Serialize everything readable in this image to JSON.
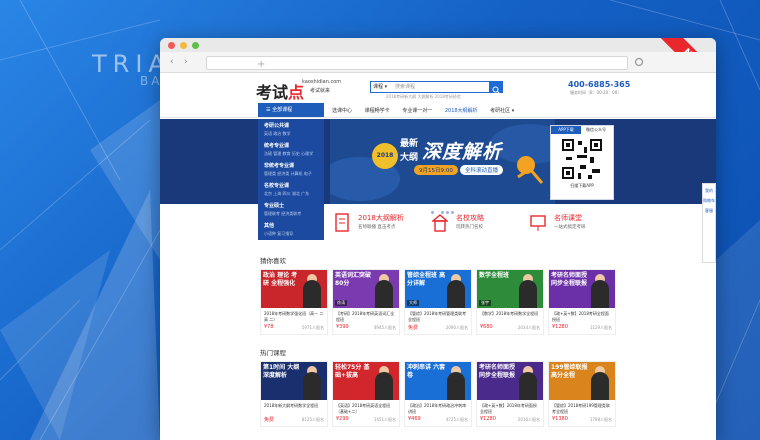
{
  "background": {
    "title": "TRIA",
    "subtitle": "BA"
  },
  "browser": {
    "ribbon": "NEW",
    "back": "‹",
    "forward": "›",
    "new_tab": "+"
  },
  "header": {
    "logo_main": "考试",
    "logo_accent": "点",
    "logo_domain": "kaoshidian.com",
    "logo_tagline": "考试就来",
    "search_select": "课程 ▾",
    "search_placeholder": "搜索课程",
    "hot_links": "2018考研新大纲  大纲解析  2018考研经验",
    "phone": "400-6885-365",
    "phone_hours": "服务时间（8：00-20：00）"
  },
  "menu": {
    "all_categories": "全部课程",
    "items": [
      "选课中心",
      "课程畅学卡",
      "专业课一对一",
      "2018大纲解析",
      "考研社区 ▾"
    ],
    "active_index": 3
  },
  "categories": [
    {
      "title": "考研公共课",
      "sub": "英语 政治 数学"
    },
    {
      "title": "统考专业课",
      "sub": "法硕 管理 教育 历史 心理学"
    },
    {
      "title": "非统考专业课",
      "sub": "管理类 经济类 计算机 电子"
    },
    {
      "title": "名校专业课",
      "sub": "北京 上海 四川 湖北 广东"
    },
    {
      "title": "专业硕士",
      "sub": "管理联考 经济类联考"
    },
    {
      "title": "其他",
      "sub": "小语种 复习指导"
    }
  ],
  "banner": {
    "year": "2018",
    "line1": "最新",
    "line2": "大纲",
    "headline": "深度解析",
    "date": "9月15日9:00",
    "live": "全科滚动直播"
  },
  "qr": {
    "tab1": "APP下载",
    "tab2": "微信公众号",
    "caption": "扫描下载APP"
  },
  "features": [
    {
      "title": "2018大纲解析",
      "sub": "名师联播  直击考点"
    },
    {
      "title": "名校攻略",
      "sub": "玩转热门名校"
    },
    {
      "title": "名师课堂",
      "sub": "一站式搞定考研"
    }
  ],
  "section1": {
    "title": "猜你喜欢",
    "cards": [
      {
        "caption": "政治 理论 考研 全程强化",
        "tag": "",
        "title": "2018年考研数学强化班（高一 二高 二）",
        "price": "¥78",
        "count": "5971人报名",
        "color": "#c9262c"
      },
      {
        "caption": "英语词汇突破80分",
        "tag": "徐涛",
        "title": "【考研】2018年考研英语词汇全程班",
        "price": "¥399",
        "count": "4945人报名",
        "color": "#7b3bb0"
      },
      {
        "caption": "管综全程班 高分详解",
        "tag": "大师",
        "title": "【管综】2018年考研管理类联考全程班",
        "price": "免费",
        "count": "2090人报名",
        "color": "#1a6fd6"
      },
      {
        "caption": "数学全程班",
        "tag": "张宇",
        "title": "【数学】2018年考研数学全程班",
        "price": "¥680",
        "count": "2034人报名",
        "color": "#2c8c3a"
      },
      {
        "caption": "考研名师面授 同步全程联报",
        "tag": "",
        "title": "【政+英+数】2018考研全程面授班",
        "price": "¥1280",
        "count": "1129人报名",
        "color": "#6b2fa8"
      }
    ]
  },
  "section2": {
    "title": "热门课程",
    "cards": [
      {
        "caption": "第1时间 大纲深度解析",
        "tag": "",
        "title": "2018年新大纲考研数学全程班",
        "price": "免费",
        "count": "8125人报名",
        "color": "#1a2f6e"
      },
      {
        "caption": "轻松75分 基础+拔高",
        "tag": "",
        "title": "【英语】2018考研英语全程班（基础+二）",
        "price": "¥299",
        "count": "1451人报名",
        "color": "#d2262d"
      },
      {
        "caption": "冲刺串讲 六套卷",
        "tag": "",
        "title": "【政治】2018年考研政治冲刺串讲班",
        "price": "¥469",
        "count": "4725人报名",
        "color": "#1a6fd6"
      },
      {
        "caption": "考研名师面授 同步全程联报",
        "tag": "",
        "title": "【政+英+数】2018年考研面授全程班",
        "price": "¥1280",
        "count": "2016人报名",
        "color": "#4a2b8c"
      },
      {
        "caption": "199管综联报 高分全程",
        "tag": "",
        "title": "【管综】2018考研199管理类联考全程班",
        "price": "¥1380",
        "count": "1798人报名",
        "color": "#d9841c"
      }
    ]
  },
  "rightbar": [
    "我的",
    "购物车",
    "客服"
  ]
}
